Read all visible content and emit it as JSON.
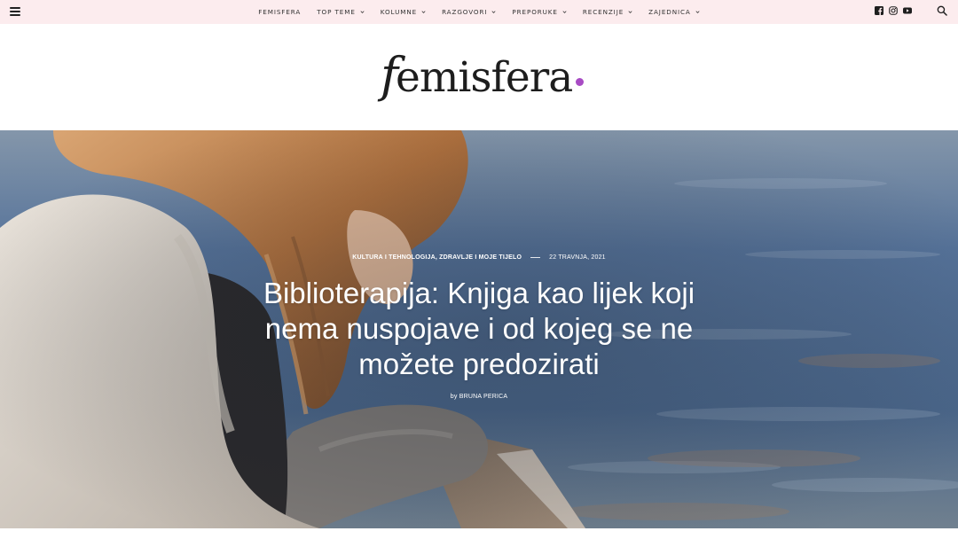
{
  "nav": {
    "items": [
      {
        "label": "FEMISFERA",
        "dropdown": false
      },
      {
        "label": "TOP TEME",
        "dropdown": true
      },
      {
        "label": "KOLUMNE",
        "dropdown": true
      },
      {
        "label": "RAZGOVORI",
        "dropdown": true
      },
      {
        "label": "PREPORUKE",
        "dropdown": true
      },
      {
        "label": "RECENZIJE",
        "dropdown": true
      },
      {
        "label": "ZAJEDNICA",
        "dropdown": true
      }
    ],
    "menu_icon": "hamburger-menu-icon",
    "social_icons": [
      "facebook-icon",
      "instagram-icon",
      "youtube-icon"
    ],
    "search_icon": "search-icon"
  },
  "logo": {
    "initial": "f",
    "rest": "emisfera",
    "dot_color": "#a84bc4"
  },
  "article": {
    "categories": "KULTURA I TEHNOLOGIJA, ZDRAVLJE I MOJE TIJELO",
    "date": "22 TRAVNJA, 2021",
    "title": "Biblioterapija: Knjiga kao lijek koji nema nuspojave i od kojeg se ne možete predozirati",
    "by_label": "by",
    "author": "BRUNA PERICA"
  },
  "colors": {
    "topbar_bg": "#fcecee",
    "accent": "#a84bc4"
  }
}
